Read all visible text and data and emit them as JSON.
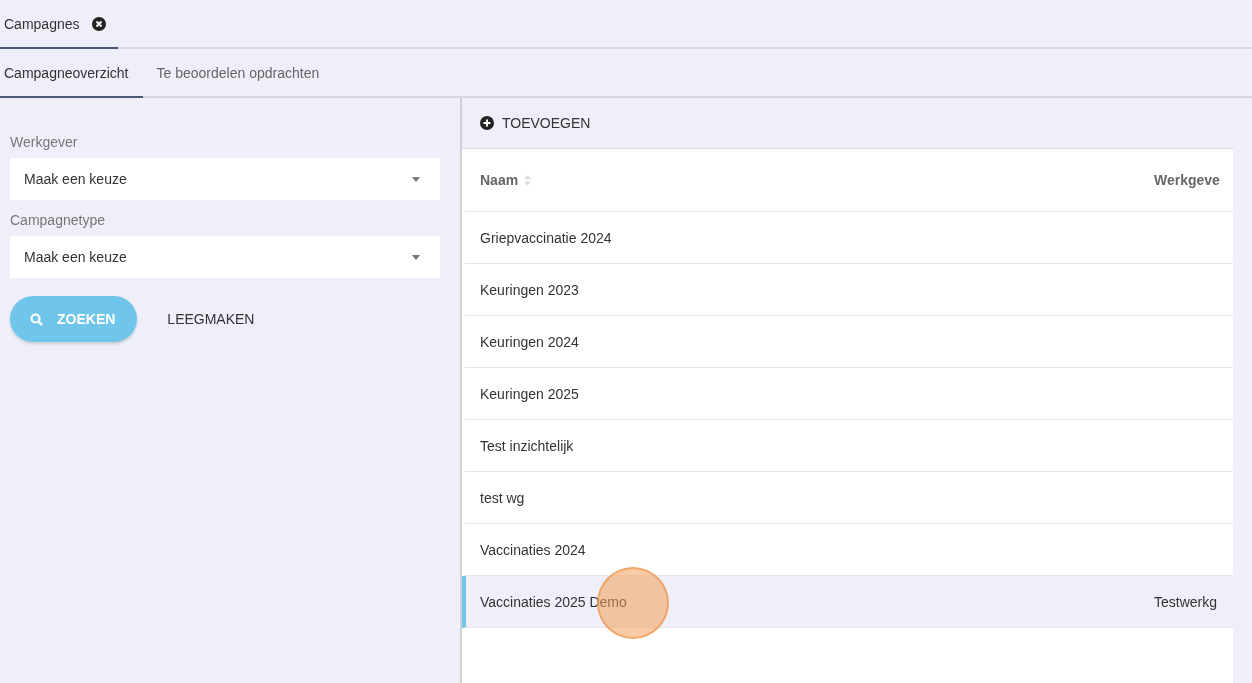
{
  "module_tabs": [
    {
      "label": "Campagnes",
      "selected": true
    }
  ],
  "sub_tabs": [
    {
      "label": "Campagneoverzicht",
      "selected": true
    },
    {
      "label": "Te beoordelen opdrachten",
      "selected": false
    }
  ],
  "filters": [
    {
      "label": "Werkgever",
      "value": "Maak een keuze"
    },
    {
      "label": "Campagnetype",
      "value": "Maak een keuze"
    }
  ],
  "search_button": "ZOEKEN",
  "clear_button": "LEEGMAKEN",
  "add_button": "TOEVOEGEN",
  "table": {
    "columns": [
      "Naam",
      "Werkgeve"
    ],
    "rows": [
      {
        "cells": [
          "Griepvaccinatie 2024",
          ""
        ],
        "selected": false
      },
      {
        "cells": [
          "Keuringen 2023",
          ""
        ],
        "selected": false
      },
      {
        "cells": [
          "Keuringen 2024",
          ""
        ],
        "selected": false
      },
      {
        "cells": [
          "Keuringen 2025",
          ""
        ],
        "selected": false
      },
      {
        "cells": [
          "Test inzichtelijk",
          ""
        ],
        "selected": false
      },
      {
        "cells": [
          "test wg",
          ""
        ],
        "selected": false
      },
      {
        "cells": [
          "Vaccinaties 2024",
          ""
        ],
        "selected": false
      },
      {
        "cells": [
          "Vaccinaties 2025 Demo",
          "Testwerkg"
        ],
        "selected": true
      }
    ]
  }
}
